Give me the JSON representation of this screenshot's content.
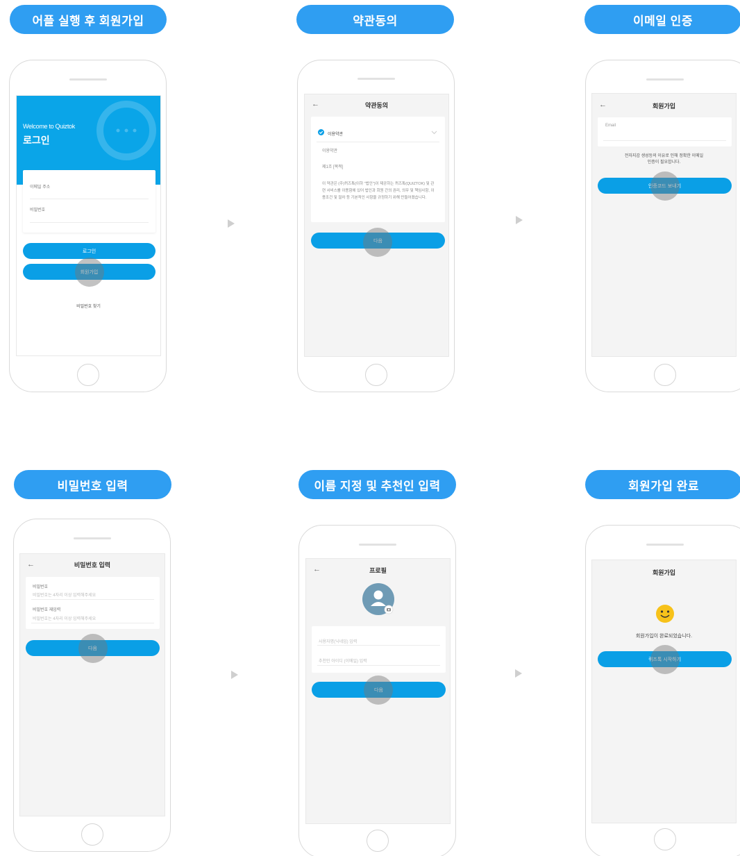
{
  "steps": [
    {
      "title": "어플 실행 후 회원가입"
    },
    {
      "title": "약관동의"
    },
    {
      "title": "이메일 인증"
    },
    {
      "title": "비밀번호 입력"
    },
    {
      "title": "이름 지정 및 추천인 입력"
    },
    {
      "title": "회원가입 완료"
    }
  ],
  "login": {
    "welcome": "Welcome to Quiztok",
    "heading": "로그인",
    "email_label": "이메일 주소",
    "password_label": "비밀번호",
    "login_button": "로그인",
    "signup_button": "회원가입",
    "find_password": "비밀번호 찾기",
    "brand_color": "#0aa5e8"
  },
  "terms": {
    "header": "약관동의",
    "check_label": "이용약관",
    "subtitle": "이용약관",
    "article": "제1조 [목적]",
    "body": "이 약관은 (주)퀴즈톡(이하 \"법인\")이 제공하는 퀴즈톡(QUIZTOK) 및 관련 서비스를 이용함에 있어 법인과 회원 간의 권리, 의무 및 책임사항, 이용조건 및 절차 등 기본적인 사항을 규정하기 위해 만들어졌습니다.",
    "next_button": "다음"
  },
  "email": {
    "header": "회원가입",
    "placeholder": "Email",
    "notice_line1": "전자지갑 생성등의 이유로 인해 정확한 이메일",
    "notice_line2": "인증이 필요합니다.",
    "send_button": "인증코드 보내기"
  },
  "password": {
    "header": "비밀번호 입력",
    "pw_label": "비밀번호",
    "pw_placeholder": "비밀번호는 4자리 이상 입력해주세요",
    "confirm_label": "비밀번호 재입력",
    "confirm_placeholder": "비밀번호는 4자리 이상 입력해주세요",
    "next_button": "다음"
  },
  "profile": {
    "header": "프로필",
    "nickname_placeholder": "사용자명(닉네임) 입력",
    "referrer_placeholder": "추천인 아이디 (이메일) 입력",
    "next_button": "다음"
  },
  "done": {
    "header": "회원가입",
    "message": "회원가입이 완료되었습니다.",
    "start_button": "퀴즈톡 시작하기"
  },
  "colors": {
    "pill": "#2f9ef2",
    "button": "#0a9fe6",
    "smiley": "#f7c21a"
  }
}
